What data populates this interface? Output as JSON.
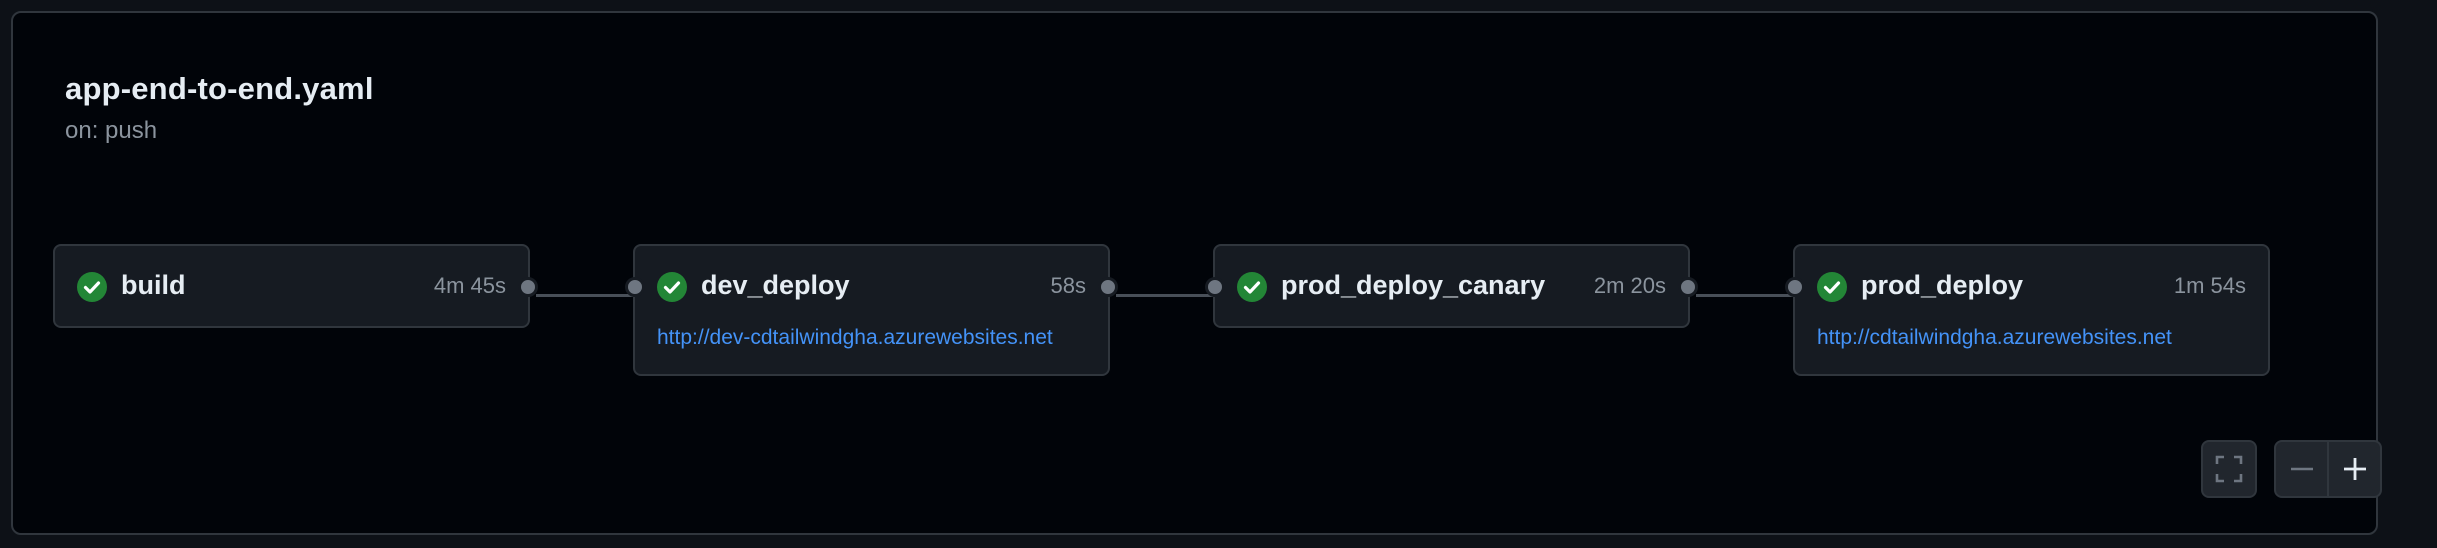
{
  "workflow": {
    "title": "app-end-to-end.yaml",
    "trigger": "on: push"
  },
  "jobs": [
    {
      "name": "build",
      "duration": "4m 45s",
      "status": "success",
      "link": ""
    },
    {
      "name": "dev_deploy",
      "duration": "58s",
      "status": "success",
      "link": "http://dev-cdtailwindgha.azurewebsites.net"
    },
    {
      "name": "prod_deploy_canary",
      "duration": "2m 20s",
      "status": "success",
      "link": ""
    },
    {
      "name": "prod_deploy",
      "duration": "1m 54s",
      "status": "success",
      "link": "http://cdtailwindgha.azurewebsites.net"
    }
  ],
  "controls": {
    "fullscreen_icon": "fullscreen-icon",
    "zoom_out_icon": "minus-icon",
    "zoom_in_icon": "plus-icon"
  },
  "colors": {
    "success": "#238636",
    "link": "#4493f8",
    "background": "#010409"
  }
}
